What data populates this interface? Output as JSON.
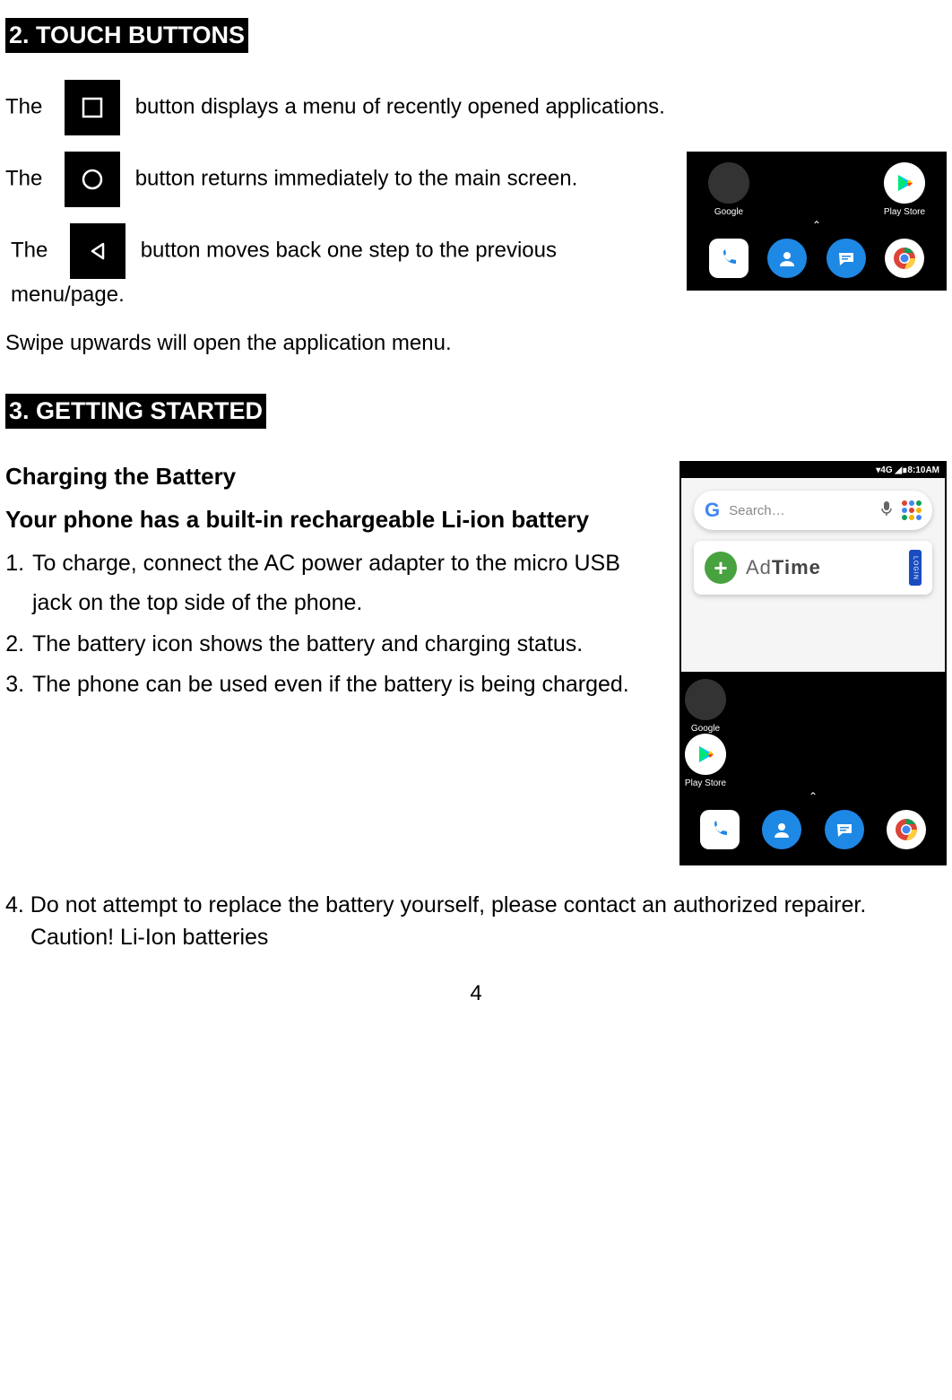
{
  "section2": {
    "heading": "2.   TOUCH BUTTONS",
    "recent_pre": "The",
    "recent_post": " button displays a menu of recently opened applications.",
    "home_pre": "The",
    "home_post": " button returns immediately to the main screen.",
    "back_pre": "The",
    "back_post": " button moves back one step to the previous menu/page.",
    "swipe": "Swipe upwards will open the application menu."
  },
  "section3": {
    "heading": "3.   GETTING STARTED",
    "sub1": "Charging the Battery",
    "sub2": "Your phone has a built-in rechargeable  Li-ion battery",
    "items": {
      "1": "To charge, connect the AC power adapter to the micro USB jack on the top side of the phone.",
      "2": "The battery icon shows the battery and charging status.",
      "3": "The phone can be used even if the battery is being charged.",
      "4": "4. Do not attempt to replace the battery yourself, please contact an authorized repairer. Caution! Li-Ion batteries"
    }
  },
  "screenshots": {
    "apps": {
      "google": "Google",
      "playstore": "Play Store"
    },
    "statusbar": "▾4G ◢∎8:10AM",
    "search_placeholder": "Search…",
    "adtime_plain": "Ad",
    "adtime_bold": "Time",
    "login": "LOGIN"
  },
  "page_number": "4"
}
